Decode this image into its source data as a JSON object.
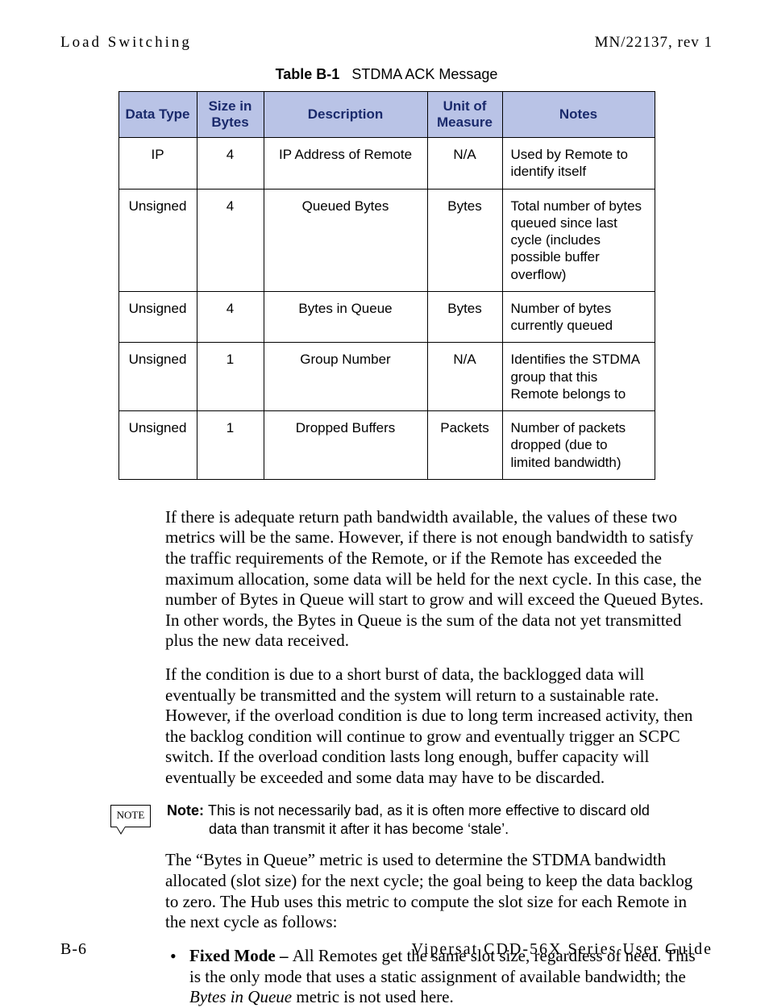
{
  "header": {
    "left": "Load Switching",
    "right": "MN/22137, rev 1"
  },
  "table": {
    "caption_label": "Table B-1",
    "caption_title": "STDMA ACK Message",
    "headers": {
      "data_type": "Data Type",
      "size": "Size in Bytes",
      "description": "Description",
      "unit": "Unit of Measure",
      "notes": "Notes"
    },
    "rows": [
      {
        "data_type": "IP",
        "size": "4",
        "description": "IP Address of Remote",
        "unit": "N/A",
        "notes": "Used by Remote to identify itself"
      },
      {
        "data_type": "Unsigned",
        "size": "4",
        "description": "Queued Bytes",
        "unit": "Bytes",
        "notes": "Total number of bytes queued since last cycle (includes possible buffer overflow)"
      },
      {
        "data_type": "Unsigned",
        "size": "4",
        "description": "Bytes in Queue",
        "unit": "Bytes",
        "notes": "Number of bytes currently queued"
      },
      {
        "data_type": "Unsigned",
        "size": "1",
        "description": "Group Number",
        "unit": "N/A",
        "notes": "Identifies the STDMA group that this Remote belongs to"
      },
      {
        "data_type": "Unsigned",
        "size": "1",
        "description": "Dropped Buffers",
        "unit": "Packets",
        "notes": "Number of packets dropped (due to limited bandwidth)"
      }
    ]
  },
  "paragraphs": {
    "p1": "If there is adequate return path bandwidth available, the values of these two metrics will be the same. However, if there is not enough bandwidth to satisfy the traffic requirements of the Remote, or if the Remote has exceeded the maximum allocation, some data will be held for the next cycle. In this case, the number of Bytes in Queue will start to grow and will exceed the Queued Bytes. In other words, the Bytes in Queue is the sum of the data not yet transmitted plus the new data received.",
    "p2": "If the condition is due to a short burst of data, the backlogged data will eventually be transmitted and the system will return to a sustainable rate. However, if the overload condition is due to long term increased activity, then the backlog condition will continue to grow and eventually trigger an SCPC switch. If the overload condition lasts long enough, buffer capacity will eventually be exceeded and some data may have to be discarded.",
    "p3": "The “Bytes in Queue” metric is used to determine the STDMA bandwidth allocated (slot size) for the next cycle; the goal being to keep the data backlog to zero. The Hub uses this metric to compute the slot size for each Remote in the next cycle as follows:"
  },
  "note": {
    "flag": "NOTE",
    "lead": "Note:",
    "line1": "This is not necessarily bad, as it is often more effective to discard old",
    "line2": "data than transmit it after it has become ‘stale’."
  },
  "bullet": {
    "lead": "Fixed Mode – ",
    "rest_a": "All Remotes get the same slot size, regardless of need. This is the only mode that uses a static assignment of available bandwidth; the ",
    "italic": "Bytes in Queue",
    "rest_b": " metric is not used here."
  },
  "footer": {
    "left": "B-6",
    "right": "Vipersat CDD-56X Series User Guide"
  }
}
